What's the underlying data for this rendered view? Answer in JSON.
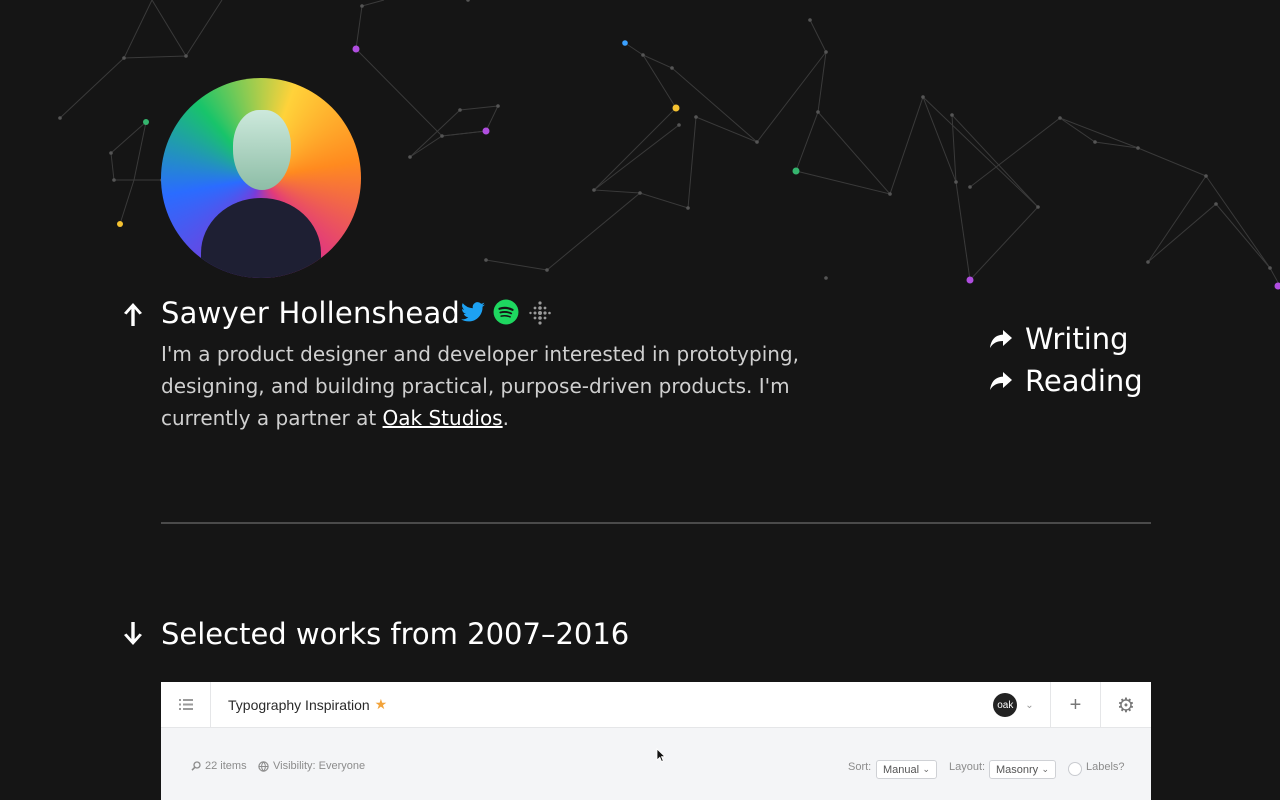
{
  "profile": {
    "name": "Sawyer Hollenshead",
    "bio_prefix": "I'm a product designer and developer interested in prototyping, designing, and building practical, purpose-driven products. I'm currently a partner at ",
    "bio_link": "Oak Studios",
    "bio_suffix": ".",
    "social": [
      "twitter-icon",
      "spotify-icon",
      "fitbit-icon"
    ]
  },
  "nav": {
    "items": [
      {
        "label": "Writing"
      },
      {
        "label": "Reading"
      }
    ]
  },
  "works": {
    "title": "Selected works from 2007–2016"
  },
  "app": {
    "collection_title": "Typography Inspiration",
    "account_badge": "oak",
    "items_count": "22 items",
    "visibility": "Visibility: Everyone",
    "sort_label": "Sort:",
    "sort_value": "Manual",
    "layout_label": "Layout:",
    "layout_value": "Masonry",
    "labels_label": "Labels?"
  },
  "colors": {
    "background": "#151515",
    "twitter": "#1da1f2",
    "spotify": "#1ed760",
    "star": "#f2a33a"
  }
}
